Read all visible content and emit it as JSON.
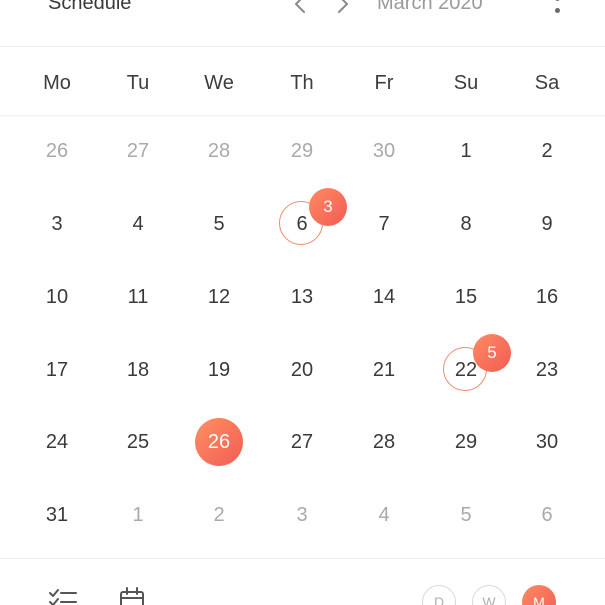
{
  "header": {
    "title": "Schedule",
    "month_label": "March 2020",
    "prev_icon": "chevron-left-icon",
    "next_icon": "chevron-right-icon",
    "more_icon": "more-vertical-icon"
  },
  "weekdays": [
    "Mo",
    "Tu",
    "We",
    "Th",
    "Fr",
    "Su",
    "Sa"
  ],
  "weeks": [
    [
      {
        "label": "26",
        "muted": true
      },
      {
        "label": "27",
        "muted": true
      },
      {
        "label": "28",
        "muted": true
      },
      {
        "label": "29",
        "muted": true
      },
      {
        "label": "30",
        "muted": true
      },
      {
        "label": "1"
      },
      {
        "label": "2"
      }
    ],
    [
      {
        "label": "3"
      },
      {
        "label": "4"
      },
      {
        "label": "5"
      },
      {
        "label": "6",
        "events": "3"
      },
      {
        "label": "7"
      },
      {
        "label": "8"
      },
      {
        "label": "9"
      }
    ],
    [
      {
        "label": "10"
      },
      {
        "label": "11"
      },
      {
        "label": "12"
      },
      {
        "label": "13"
      },
      {
        "label": "14"
      },
      {
        "label": "15"
      },
      {
        "label": "16"
      }
    ],
    [
      {
        "label": "17"
      },
      {
        "label": "18"
      },
      {
        "label": "19"
      },
      {
        "label": "20"
      },
      {
        "label": "21"
      },
      {
        "label": "22",
        "events": "5"
      },
      {
        "label": "23"
      }
    ],
    [
      {
        "label": "24"
      },
      {
        "label": "25"
      },
      {
        "label": "26",
        "today": true
      },
      {
        "label": "27"
      },
      {
        "label": "28"
      },
      {
        "label": "29"
      },
      {
        "label": "30"
      }
    ],
    [
      {
        "label": "31"
      },
      {
        "label": "1",
        "muted": true
      },
      {
        "label": "2",
        "muted": true
      },
      {
        "label": "3",
        "muted": true
      },
      {
        "label": "4",
        "muted": true
      },
      {
        "label": "5",
        "muted": true
      },
      {
        "label": "6",
        "muted": true
      }
    ]
  ],
  "footer": {
    "list_icon": "checklist-icon",
    "calendar_icon": "calendar-icon",
    "view_buttons": [
      {
        "label": "D",
        "selected": false
      },
      {
        "label": "W",
        "selected": false
      },
      {
        "label": "M",
        "selected": true
      }
    ]
  },
  "colors": {
    "accent": "#f46a57",
    "accent_light": "#ff8a63",
    "text": "#3a3a3a",
    "muted_text": "#a9a9a9"
  }
}
